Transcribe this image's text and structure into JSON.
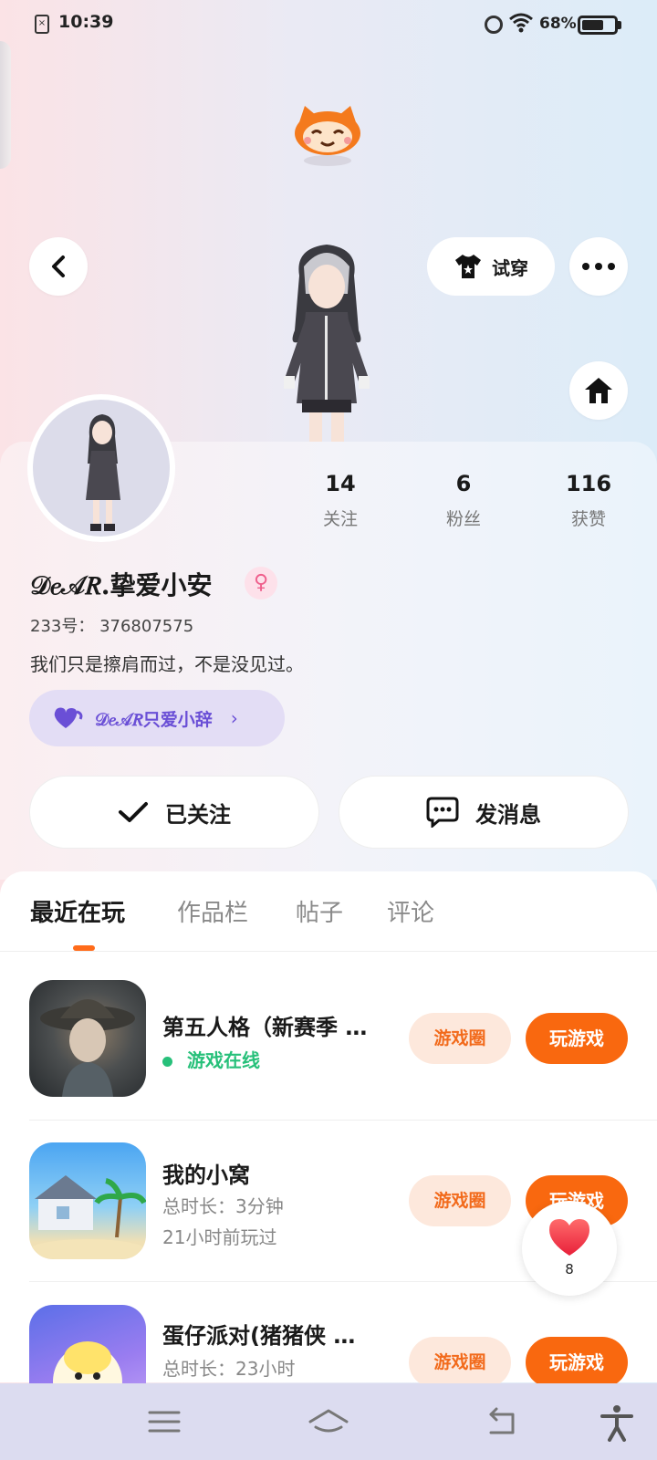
{
  "status_bar": {
    "time": "10:39",
    "battery": "68%",
    "battery_level": 0.68
  },
  "header": {
    "tryon_label": "试穿"
  },
  "stats": [
    {
      "value": "14",
      "label": "关注"
    },
    {
      "value": "6",
      "label": "粉丝"
    },
    {
      "value": "116",
      "label": "获赞"
    }
  ],
  "profile": {
    "nickname": "𝒟𝑒𝒜𝑅.挚爱小安",
    "gender_symbol": "♀",
    "uid": "233号：  376807575",
    "bio": "我们只是擦肩而过，不是没见过。",
    "club": "𝒟𝑒𝒜𝑅只爱小辞"
  },
  "actions": {
    "follow_label": "已关注",
    "message_label": "发消息"
  },
  "tabs": [
    {
      "label": "最近在玩",
      "active": true
    },
    {
      "label": "作品栏",
      "active": false
    },
    {
      "label": "帖子",
      "active": false
    },
    {
      "label": "评论",
      "active": false
    }
  ],
  "games": [
    {
      "title": "第五人格（新赛季 …",
      "status": "游戏在线",
      "circle": "游戏圈",
      "play": "玩游戏"
    },
    {
      "title": "我的小窝",
      "duration": "总时长：3分钟",
      "last_played": "21小时前玩过",
      "circle": "游戏圈",
      "play": "玩游戏"
    },
    {
      "title": "蛋仔派对(猪猪侠 …",
      "duration": "总时长：23小时",
      "circle": "游戏圈",
      "play": "玩游戏"
    }
  ],
  "like_fab": {
    "count": "8"
  },
  "colors": {
    "accent": "#f9680f",
    "online": "#27c07a",
    "club": "#6a4fd6"
  }
}
